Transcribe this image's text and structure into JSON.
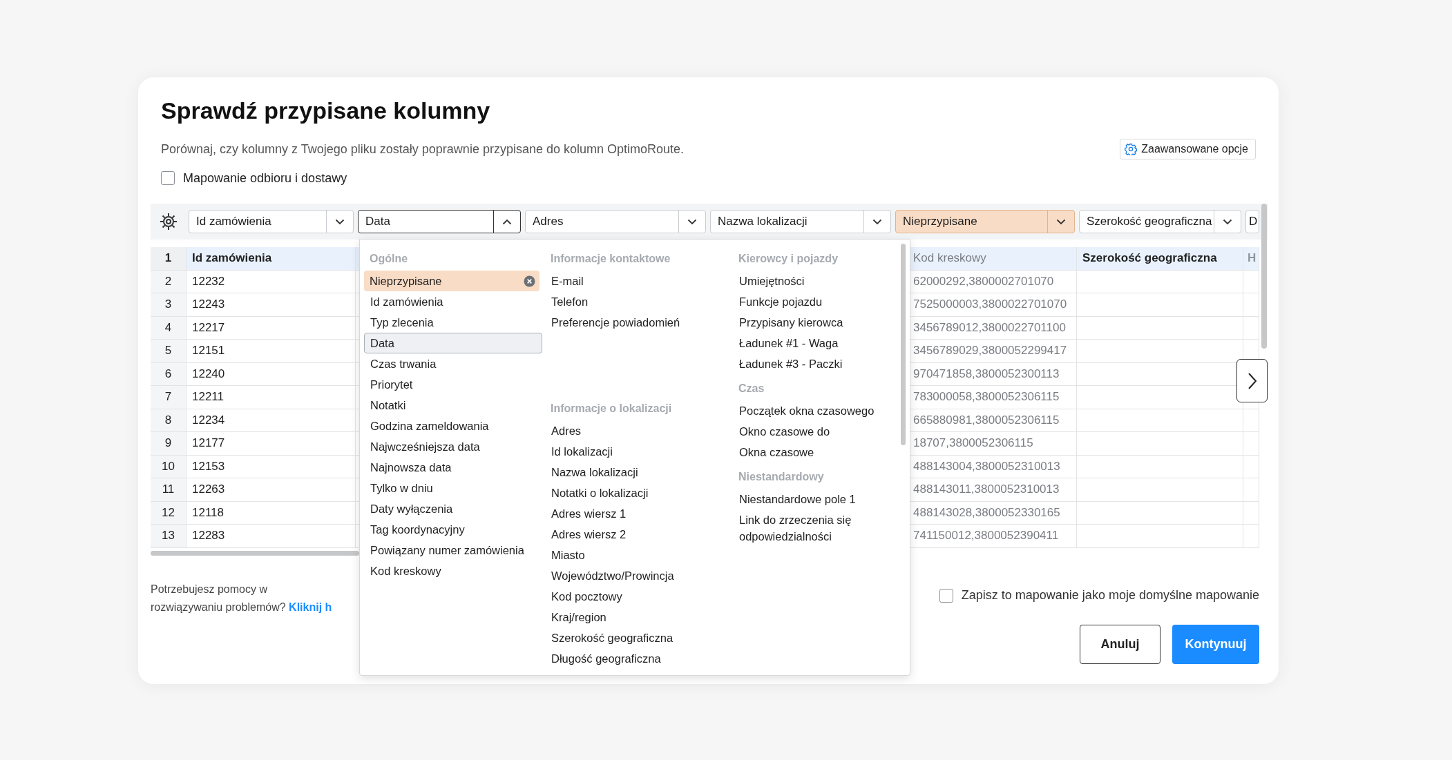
{
  "title": "Sprawdź przypisane kolumny",
  "subtitle": "Porównaj, czy kolumny z Twojego pliku zostały poprawnie przypisane do kolumn OptimoRoute.",
  "advanced_button": "Zaawansowane opcje",
  "pickup_delivery": {
    "label": "Mapowanie odbioru i dostawy",
    "checked": false
  },
  "column_selects": [
    {
      "label": "Id zamówienia",
      "unassigned": false,
      "open": false
    },
    {
      "label": "Data",
      "unassigned": false,
      "open": true
    },
    {
      "label": "Adres",
      "unassigned": false,
      "open": false
    },
    {
      "label": "Nazwa lokalizacji",
      "unassigned": false,
      "open": false
    },
    {
      "label": "Nieprzypisane",
      "unassigned": true,
      "open": false
    },
    {
      "label": "Szerokość geograficzna",
      "unassigned": false,
      "open": false
    },
    {
      "label": "D",
      "unassigned": false,
      "open": false
    }
  ],
  "header_row": {
    "number": "1",
    "order_id": "Id zamówienia",
    "barcode": "Kod kreskowy",
    "latitude": "Szerokość geograficzna",
    "column_7": "H"
  },
  "rows": [
    {
      "number": "2",
      "order_id": "12232",
      "barcode": "62000292,3800002701070"
    },
    {
      "number": "3",
      "order_id": "12243",
      "barcode": "7525000003,3800022701070"
    },
    {
      "number": "4",
      "order_id": "12217",
      "barcode": "3456789012,3800022701100"
    },
    {
      "number": "5",
      "order_id": "12151",
      "barcode": "3456789029,3800052299417"
    },
    {
      "number": "6",
      "order_id": "12240",
      "barcode": "970471858,3800052300113"
    },
    {
      "number": "7",
      "order_id": "12211",
      "barcode": "783000058,3800052306115"
    },
    {
      "number": "8",
      "order_id": "12234",
      "barcode": "665880981,3800052306115"
    },
    {
      "number": "9",
      "order_id": "12177",
      "barcode": "18707,3800052306115"
    },
    {
      "number": "10",
      "order_id": "12153",
      "barcode": "488143004,3800052310013"
    },
    {
      "number": "11",
      "order_id": "12263",
      "barcode": "488143011,3800052310013"
    },
    {
      "number": "12",
      "order_id": "12118",
      "barcode": "488143028,3800052330165"
    },
    {
      "number": "13",
      "order_id": "12283",
      "barcode": "741150012,3800052390411"
    }
  ],
  "field_menu": {
    "columns": [
      {
        "sections": [
          {
            "heading": "Ogólne",
            "unassigned_option": "Nieprzypisane",
            "items": [
              {
                "label": "Id zamówienia",
                "selected": false
              },
              {
                "label": "Typ zlecenia",
                "selected": false
              },
              {
                "label": "Data",
                "selected": true
              },
              {
                "label": "Czas trwania",
                "selected": false
              },
              {
                "label": "Priorytet",
                "selected": false
              },
              {
                "label": "Notatki",
                "selected": false
              },
              {
                "label": "Godzina zameldowania",
                "selected": false
              },
              {
                "label": "Najwcześniejsza data",
                "selected": false
              },
              {
                "label": "Najnowsza data",
                "selected": false
              },
              {
                "label": "Tylko w dniu",
                "selected": false
              },
              {
                "label": "Daty wyłączenia",
                "selected": false
              },
              {
                "label": "Tag koordynacyjny",
                "selected": false
              },
              {
                "label": "Powiązany numer zamówienia",
                "selected": false
              },
              {
                "label": "Kod kreskowy",
                "selected": false
              }
            ]
          }
        ]
      },
      {
        "sections": [
          {
            "heading": "Informacje kontaktowe",
            "items": [
              {
                "label": "E-mail",
                "selected": false
              },
              {
                "label": "Telefon",
                "selected": false
              },
              {
                "label": "Preferencje powiadomień",
                "selected": false
              }
            ]
          },
          {
            "heading": "Informacje o lokalizacji",
            "items": [
              {
                "label": "Adres",
                "selected": false
              },
              {
                "label": "Id lokalizacji",
                "selected": false
              },
              {
                "label": "Nazwa lokalizacji",
                "selected": false
              },
              {
                "label": "Notatki o lokalizacji",
                "selected": false
              },
              {
                "label": "Adres wiersz 1",
                "selected": false
              },
              {
                "label": "Adres wiersz 2",
                "selected": false
              },
              {
                "label": "Miasto",
                "selected": false
              },
              {
                "label": "Województwo/Prowincja",
                "selected": false
              },
              {
                "label": "Kod pocztowy",
                "selected": false
              },
              {
                "label": "Kraj/region",
                "selected": false
              },
              {
                "label": "Szerokość geograficzna",
                "selected": false
              },
              {
                "label": "Długość geograficzna",
                "selected": false
              }
            ]
          }
        ]
      },
      {
        "sections": [
          {
            "heading": "Kierowcy i pojazdy",
            "items": [
              {
                "label": "Umiejętności",
                "selected": false
              },
              {
                "label": "Funkcje pojazdu",
                "selected": false
              },
              {
                "label": "Przypisany kierowca",
                "selected": false
              },
              {
                "label": "Ładunek #1 - Waga",
                "selected": false
              },
              {
                "label": "Ładunek #3 - Paczki",
                "selected": false
              }
            ]
          },
          {
            "heading": "Czas",
            "items": [
              {
                "label": "Początek okna czasowego",
                "selected": false
              },
              {
                "label": "Okno czasowe do",
                "selected": false
              },
              {
                "label": "Okna czasowe",
                "selected": false
              }
            ]
          },
          {
            "heading": "Niestandardowy",
            "items": [
              {
                "label": "Niestandardowe pole 1",
                "selected": false
              },
              {
                "label": "Link do zrzeczenia się odpowiedzialności",
                "selected": false
              }
            ]
          }
        ]
      }
    ]
  },
  "help": {
    "text": "Potrzebujesz pomocy w rozwiązywaniu problemów?",
    "link": "Kliknij h"
  },
  "save_default": {
    "label": "Zapisz to mapowanie jako moje domyślne mapowanie",
    "checked": false
  },
  "buttons": {
    "cancel": "Anuluj",
    "continue": "Kontynuuj"
  }
}
